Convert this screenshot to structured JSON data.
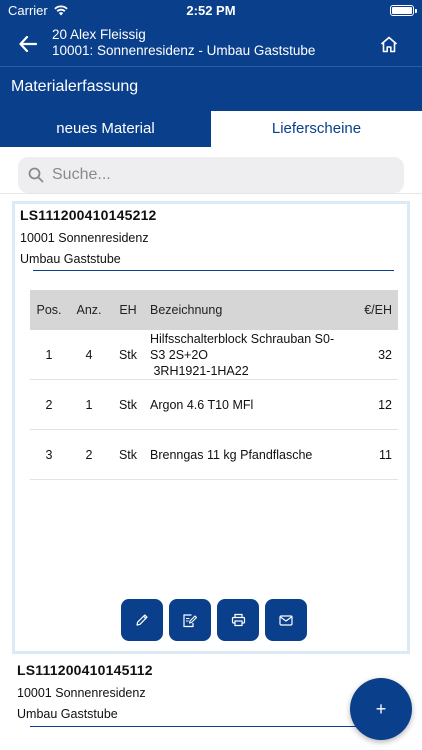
{
  "status": {
    "carrier": "Carrier",
    "time": "2:52 PM"
  },
  "nav": {
    "line1": "20 Alex Fleissig",
    "line2": "10001: Sonnenresidenz - Umbau Gaststube"
  },
  "section": {
    "title": "Materialerfassung"
  },
  "tabs": [
    {
      "label": "neues Material",
      "active": false
    },
    {
      "label": "Lieferscheine",
      "active": true
    }
  ],
  "search": {
    "placeholder": "Suche..."
  },
  "colors": {
    "primary": "#0a3f8c",
    "card_border": "#dceaf5",
    "table_header": "#d6d6d6"
  },
  "deliveries": [
    {
      "number": "LS111200410145212",
      "project": "10001  Sonnenresidenz",
      "description": "Umbau Gaststube",
      "table": {
        "headers": [
          "Pos.",
          "Anz.",
          "EH",
          "Bezeichnung",
          "€/EH"
        ],
        "rows": [
          {
            "pos": "1",
            "anz": "4",
            "eh": "Stk",
            "bez": [
              "Hilfsschalterblock Schrauban S0-",
              "S3 2S+2O",
              " 3RH1921-1HA22"
            ],
            "preis": "32"
          },
          {
            "pos": "2",
            "anz": "1",
            "eh": "Stk",
            "bez": [
              "Argon 4.6 T10 MFl"
            ],
            "preis": "12"
          },
          {
            "pos": "3",
            "anz": "2",
            "eh": "Stk",
            "bez": [
              "Brenngas 11 kg Pfandflasche"
            ],
            "preis": "11"
          }
        ]
      },
      "actions": [
        "pencil-icon",
        "edit-document-icon",
        "printer-icon",
        "mail-icon"
      ]
    },
    {
      "number": "LS111200410145112",
      "project": "10001  Sonnenresidenz",
      "description": "Umbau Gaststube"
    }
  ],
  "fab": {
    "label": "+"
  }
}
